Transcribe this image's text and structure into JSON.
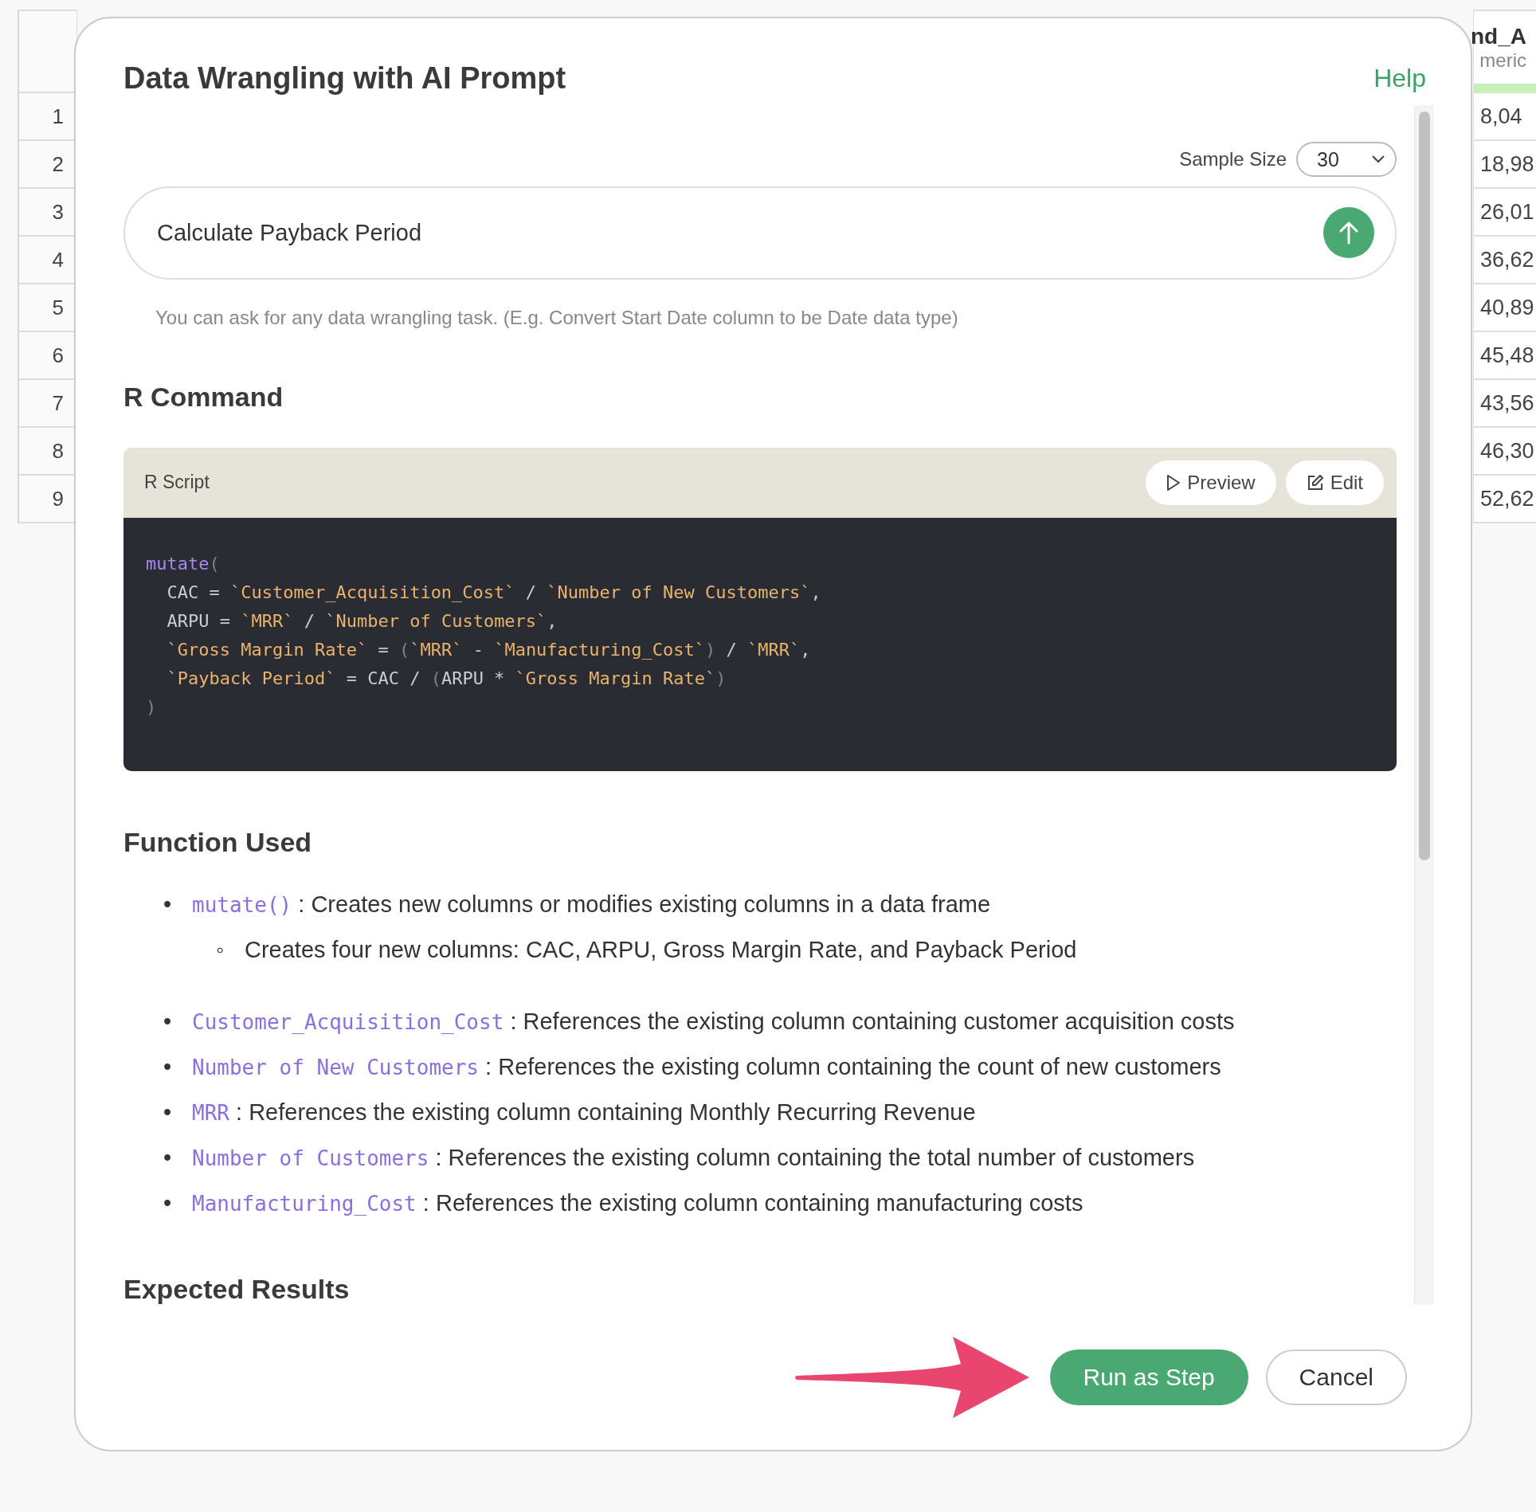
{
  "sheet": {
    "column_header": "nd_A",
    "column_type": "meric",
    "rows": [
      {
        "num": "1",
        "value": "8,04"
      },
      {
        "num": "2",
        "value": "18,98"
      },
      {
        "num": "3",
        "value": "26,01"
      },
      {
        "num": "4",
        "value": "36,62"
      },
      {
        "num": "5",
        "value": "40,89"
      },
      {
        "num": "6",
        "value": "45,48"
      },
      {
        "num": "7",
        "value": "43,56"
      },
      {
        "num": "8",
        "value": "46,30"
      },
      {
        "num": "9",
        "value": "52,62"
      }
    ]
  },
  "dialog": {
    "title": "Data Wrangling with AI Prompt",
    "help": "Help",
    "sample_size": {
      "label": "Sample Size",
      "value": "30"
    },
    "prompt": {
      "value": "Calculate Payback Period"
    },
    "hint": "You can ask for any data wrangling task. (E.g. Convert Start Date column to be Date data type)",
    "r_command": {
      "heading": "R Command",
      "script_label": "R Script",
      "buttons": [
        "Preview",
        "Edit"
      ],
      "lines": [
        [
          {
            "kind": "fn",
            "text": "mutate"
          },
          {
            "kind": "paren",
            "text": "("
          }
        ],
        [
          {
            "kind": "plain",
            "text": "  CAC = "
          },
          {
            "kind": "str",
            "text": "`Customer_Acquisition_Cost`"
          },
          {
            "kind": "plain",
            "text": " / "
          },
          {
            "kind": "str",
            "text": "`Number of New Customers`"
          },
          {
            "kind": "plain",
            "text": ","
          }
        ],
        [
          {
            "kind": "plain",
            "text": "  ARPU = "
          },
          {
            "kind": "str",
            "text": "`MRR`"
          },
          {
            "kind": "plain",
            "text": " / "
          },
          {
            "kind": "str",
            "text": "`Number of Customers`"
          },
          {
            "kind": "plain",
            "text": ","
          }
        ],
        [
          {
            "kind": "str",
            "text": "  `Gross Margin Rate`"
          },
          {
            "kind": "plain",
            "text": " = "
          },
          {
            "kind": "paren",
            "text": "("
          },
          {
            "kind": "str",
            "text": "`MRR`"
          },
          {
            "kind": "plain",
            "text": " - "
          },
          {
            "kind": "str",
            "text": "`Manufacturing_Cost`"
          },
          {
            "kind": "paren",
            "text": ")"
          },
          {
            "kind": "plain",
            "text": " / "
          },
          {
            "kind": "str",
            "text": "`MRR`"
          },
          {
            "kind": "plain",
            "text": ","
          }
        ],
        [
          {
            "kind": "str",
            "text": "  `Payback Period`"
          },
          {
            "kind": "plain",
            "text": " = CAC / "
          },
          {
            "kind": "paren",
            "text": "("
          },
          {
            "kind": "plain",
            "text": "ARPU * "
          },
          {
            "kind": "str",
            "text": "`Gross Margin Rate`"
          },
          {
            "kind": "paren",
            "text": ")"
          }
        ],
        [
          {
            "kind": "paren",
            "text": ")"
          }
        ]
      ]
    },
    "functions": {
      "heading": "Function Used",
      "groups": [
        [
          {
            "marker": "•",
            "term": "mutate()",
            "text": ": Creates new columns or modifies existing columns in a data frame",
            "children": [
              {
                "marker": "◦",
                "text": "Creates four new columns: CAC, ARPU, Gross Margin Rate, and Payback Period"
              }
            ]
          }
        ],
        [
          {
            "marker": "•",
            "term": "Customer_Acquisition_Cost",
            "text": ": References the existing column containing customer acquisition costs"
          },
          {
            "marker": "•",
            "term": "Number of New Customers",
            "text": ": References the existing column containing the count of new customers"
          },
          {
            "marker": "•",
            "term": "MRR",
            "text": ": References the existing column containing Monthly Recurring Revenue"
          },
          {
            "marker": "•",
            "term": "Number of Customers",
            "text": ": References the existing column containing the total number of customers"
          },
          {
            "marker": "•",
            "term": "Manufacturing_Cost",
            "text": ": References the existing column containing manufacturing costs"
          }
        ]
      ]
    },
    "expected_heading": "Expected Results",
    "footer": {
      "primary": "Run as Step",
      "secondary": "Cancel"
    }
  }
}
